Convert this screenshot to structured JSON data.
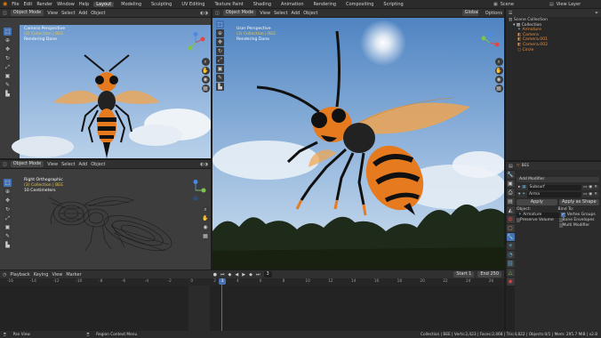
{
  "menu": {
    "items": [
      "File",
      "Edit",
      "Render",
      "Window",
      "Help"
    ],
    "workspaces": [
      "Layout",
      "Modeling",
      "Sculpting",
      "UV Editing",
      "Texture Paint",
      "Shading",
      "Animation",
      "Rendering",
      "Compositing",
      "Scripting"
    ],
    "active_workspace": "Layout",
    "scene": "Scene",
    "view_layer": "View Layer"
  },
  "viewport_header": {
    "mode": "Object Mode",
    "view": "View",
    "select": "Select",
    "add": "Add",
    "object": "Object",
    "orientation": "Global",
    "options": "Options"
  },
  "vp_top_left": {
    "perspective": "Camera Perspective",
    "collection": "(3) Collection | BEE",
    "status": "Rendering Done"
  },
  "vp_main": {
    "perspective": "User Perspective",
    "collection": "(3) Collection | BEE",
    "status": "Rendering Done"
  },
  "vp_bottom_left": {
    "perspective": "Right Orthographic",
    "collection": "(3) Collection | BEE",
    "scale": "10 Centimeters"
  },
  "outliner": {
    "root": "Scene Collection",
    "items": [
      {
        "name": "Collection",
        "level": 1
      },
      {
        "name": "Armature",
        "level": 2
      },
      {
        "name": "Camera",
        "level": 2
      },
      {
        "name": "Camera.001",
        "level": 2
      },
      {
        "name": "Camera.002",
        "level": 2
      },
      {
        "name": "Circle",
        "level": 2
      }
    ]
  },
  "properties": {
    "object_name": "BEE",
    "add_modifier": "Add Modifier",
    "modifier_name": "Subsurf",
    "modifier2_name": "Arma",
    "apply": "Apply",
    "apply_as_shape": "Apply as Shape",
    "object_label": "Object:",
    "armature": "Armature",
    "preserve_volume": "Preserve Volume",
    "bind_to": "Bind To:",
    "vertex_groups": "Vertex Groups",
    "bone_envelopes": "Bone Envelopes",
    "multi_modifier": "Multi Modifier"
  },
  "timeline": {
    "playback": "Playback",
    "keying": "Keying",
    "view": "View",
    "marker": "Marker",
    "current_frame": "3",
    "start_label": "Start",
    "start": "1",
    "end_label": "End",
    "end": "250",
    "ruler": [
      "-16",
      "-14",
      "-12",
      "-10",
      "-8",
      "-6",
      "-4",
      "-2",
      "0",
      "2",
      "4",
      "6",
      "8",
      "10",
      "12",
      "14",
      "16",
      "18",
      "20",
      "22",
      "24",
      "26"
    ]
  },
  "status": {
    "left": "Pan View",
    "middle": "Region Context Menu",
    "right": "Collection | BEE | Verts:2,423 | Faces:2,468 | Tris:4,822 | Objects:0/1 | Mem: 295.7 MiB | v2.8"
  },
  "colors": {
    "accent": "#4772b3",
    "bee_orange": "#e67a1e",
    "wing": "#f4a44a",
    "sky_top": "#5b8fc7",
    "active_frame": "#4772b3"
  }
}
